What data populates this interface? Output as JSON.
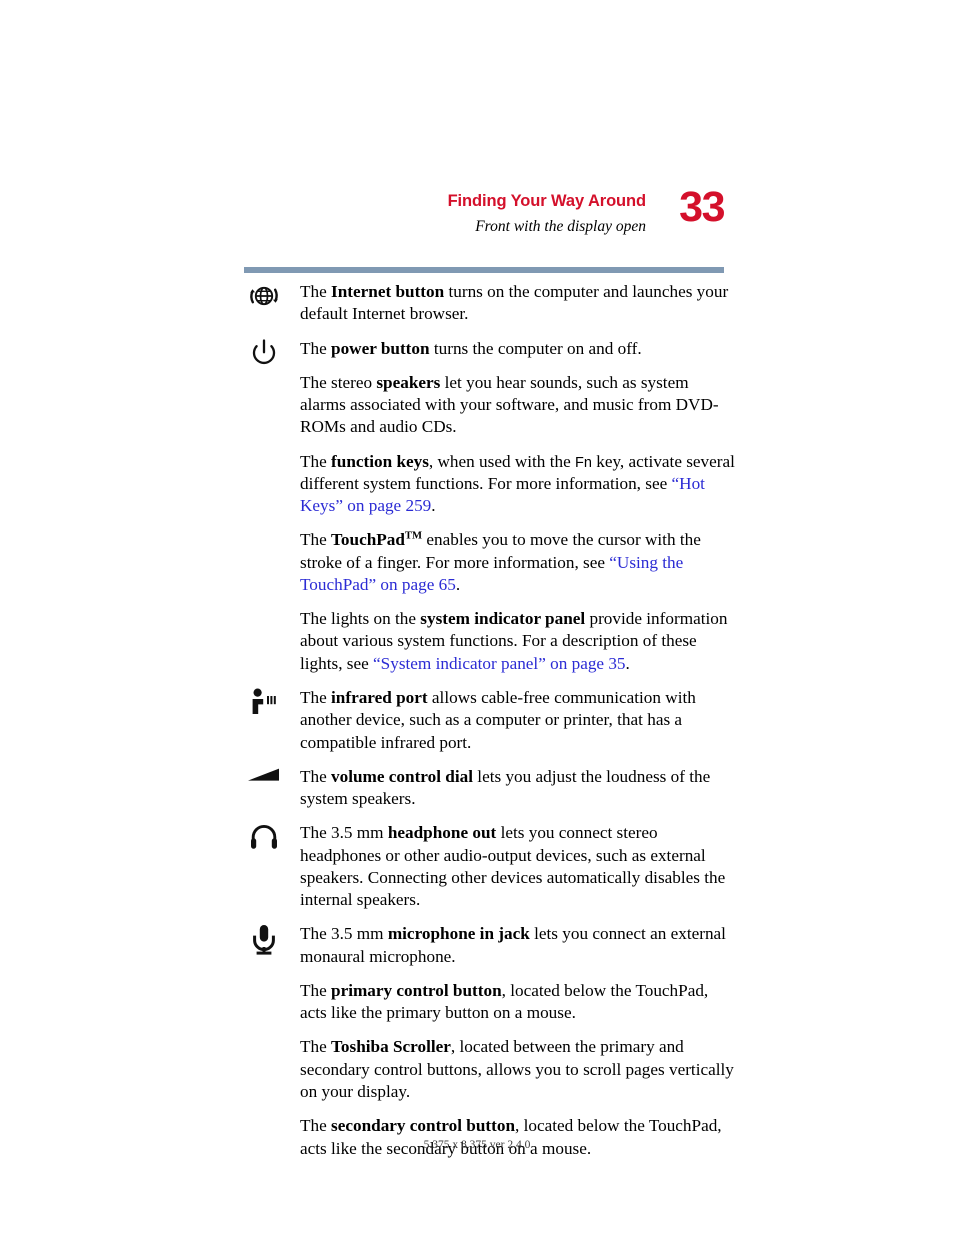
{
  "header": {
    "chapter_title": "Finding Your Way Around",
    "section_title": "Front with the display open",
    "page_number": "33",
    "accent_color": "#d4102b",
    "rule_color": "#8099b3"
  },
  "link_color": "#2b2bd4",
  "entries": [
    {
      "icon": "internet-globe-icon",
      "has_icon": true,
      "segments": [
        {
          "text": "The ",
          "style": "normal"
        },
        {
          "text": "Internet button",
          "style": "bold"
        },
        {
          "text": " turns on the computer and launches your default Internet browser.",
          "style": "normal"
        }
      ]
    },
    {
      "icon": "power-button-icon",
      "has_icon": true,
      "segments": [
        {
          "text": "The ",
          "style": "normal"
        },
        {
          "text": "power button",
          "style": "bold"
        },
        {
          "text": " turns the computer on and off.",
          "style": "normal"
        }
      ]
    },
    {
      "icon": null,
      "has_icon": false,
      "segments": [
        {
          "text": "The stereo ",
          "style": "normal"
        },
        {
          "text": "speakers",
          "style": "bold"
        },
        {
          "text": " let you hear sounds, such as system alarms associated with your software, and music from DVD-ROMs and audio CDs.",
          "style": "normal"
        }
      ]
    },
    {
      "icon": null,
      "has_icon": false,
      "segments": [
        {
          "text": "The ",
          "style": "normal"
        },
        {
          "text": "function keys",
          "style": "bold"
        },
        {
          "text": ", when used with the ",
          "style": "normal"
        },
        {
          "text": "Fn",
          "style": "keycap"
        },
        {
          "text": " key, activate several different system functions. For more information, see ",
          "style": "normal"
        },
        {
          "text": "“Hot Keys” on page 259",
          "style": "link"
        },
        {
          "text": ".",
          "style": "normal"
        }
      ]
    },
    {
      "icon": null,
      "has_icon": false,
      "segments": [
        {
          "text": "The ",
          "style": "normal"
        },
        {
          "text": "TouchPad",
          "style": "bold"
        },
        {
          "text": "TM",
          "style": "trademark"
        },
        {
          "text": " enables you to move the cursor with the stroke of a finger. For more information, see ",
          "style": "normal"
        },
        {
          "text": "“Using the TouchPad” on page 65",
          "style": "link"
        },
        {
          "text": ".",
          "style": "normal"
        }
      ]
    },
    {
      "icon": null,
      "has_icon": false,
      "segments": [
        {
          "text": "The lights on the ",
          "style": "normal"
        },
        {
          "text": "system indicator panel",
          "style": "bold"
        },
        {
          "text": " provide information about various system functions. For a description of these lights, see ",
          "style": "normal"
        },
        {
          "text": "“System indicator panel” on page 35",
          "style": "link"
        },
        {
          "text": ".",
          "style": "normal"
        }
      ]
    },
    {
      "icon": "infrared-port-icon",
      "has_icon": true,
      "segments": [
        {
          "text": "The ",
          "style": "normal"
        },
        {
          "text": "infrared port",
          "style": "bold"
        },
        {
          "text": " allows cable-free communication with another device, such as a computer or printer, that has a compatible infrared port.",
          "style": "normal"
        }
      ]
    },
    {
      "icon": "volume-dial-icon",
      "has_icon": true,
      "segments": [
        {
          "text": "The ",
          "style": "normal"
        },
        {
          "text": "volume control dial",
          "style": "bold"
        },
        {
          "text": " lets you adjust the loudness of the system speakers.",
          "style": "normal"
        }
      ]
    },
    {
      "icon": "headphone-out-icon",
      "has_icon": true,
      "segments": [
        {
          "text": "The 3.5 mm ",
          "style": "normal"
        },
        {
          "text": "headphone out",
          "style": "bold"
        },
        {
          "text": " lets you connect stereo headphones or other audio-output devices, such as external speakers. Connecting other devices automatically disables the internal speakers.",
          "style": "normal"
        }
      ]
    },
    {
      "icon": "microphone-in-icon",
      "has_icon": true,
      "segments": [
        {
          "text": "The 3.5 mm ",
          "style": "normal"
        },
        {
          "text": "microphone in jack",
          "style": "bold"
        },
        {
          "text": " lets you connect an external monaural microphone.",
          "style": "normal"
        }
      ]
    },
    {
      "icon": null,
      "has_icon": false,
      "segments": [
        {
          "text": "The ",
          "style": "normal"
        },
        {
          "text": "primary control button",
          "style": "bold"
        },
        {
          "text": ", located below the TouchPad, acts like the primary button on a mouse.",
          "style": "normal"
        }
      ]
    },
    {
      "icon": null,
      "has_icon": false,
      "segments": [
        {
          "text": "The ",
          "style": "normal"
        },
        {
          "text": "Toshiba Scroller",
          "style": "bold"
        },
        {
          "text": ", located between the primary and secondary control buttons, allows you to scroll pages vertically on your display.",
          "style": "normal"
        }
      ]
    },
    {
      "icon": null,
      "has_icon": false,
      "segments": [
        {
          "text": "The ",
          "style": "normal"
        },
        {
          "text": "secondary control button",
          "style": "bold"
        },
        {
          "text": ", located below the TouchPad, acts like the secondary button on a mouse.",
          "style": "normal"
        }
      ]
    }
  ],
  "footer": {
    "text": "5.375 x 8.375 ver 2.4.0"
  }
}
